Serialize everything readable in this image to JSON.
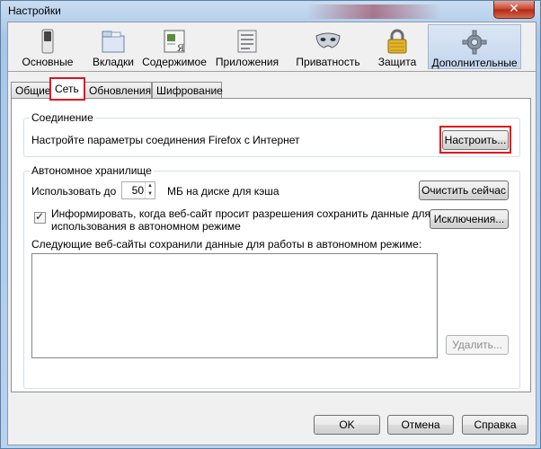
{
  "window": {
    "title": "Настройки",
    "close_glyph": "✕"
  },
  "toolbar": {
    "panes": [
      {
        "label": "Основные",
        "icon": "switch-icon"
      },
      {
        "label": "Вкладки",
        "icon": "tabs-icon"
      },
      {
        "label": "Содержимое",
        "icon": "content-icon"
      },
      {
        "label": "Приложения",
        "icon": "applications-icon"
      },
      {
        "label": "Приватность",
        "icon": "privacy-mask-icon"
      },
      {
        "label": "Защита",
        "icon": "padlock-icon"
      },
      {
        "label": "Дополнительные",
        "icon": "gear-icon",
        "selected": true
      }
    ]
  },
  "tabs": [
    {
      "label": "Общие"
    },
    {
      "label": "Сеть",
      "active": true
    },
    {
      "label": "Обновления"
    },
    {
      "label": "Шифрование"
    }
  ],
  "connection": {
    "title": "Соединение",
    "description": "Настройте параметры соединения Firefox с Интернет",
    "settings_button": "Настроить..."
  },
  "offline": {
    "title": "Автономное хранилище",
    "use_up_to": "Использовать до",
    "cache_size": "50",
    "cache_unit": "МБ на диске для кэша",
    "clear_now_button": "Очистить сейчас",
    "notify_checkbox_line1": "Информировать, когда веб-сайт просит разрешения сохранить данные для",
    "notify_checkbox_line2": "использования в автономном режиме",
    "notify_checked": true,
    "exceptions_button": "Исключения...",
    "sites_label": "Следующие веб-сайты сохранили данные для работы в автономном режиме:",
    "remove_button": "Удалить..."
  },
  "footer": {
    "ok": "OK",
    "cancel": "Отмена",
    "help": "Справка"
  },
  "colors": {
    "highlight": "#e0101e",
    "title_bar": "#a9c6e6"
  }
}
